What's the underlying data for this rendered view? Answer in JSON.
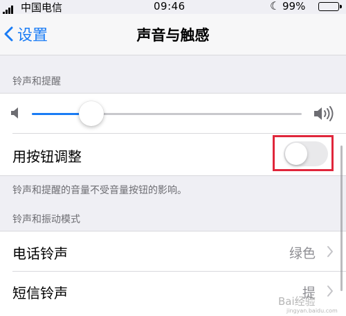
{
  "status_bar": {
    "carrier": "中国电信",
    "time": "09:46",
    "battery": "99%",
    "icons": [
      "signal-icon",
      "moon-icon",
      "battery-icon"
    ]
  },
  "nav": {
    "back_label": "设置",
    "title": "声音与触感"
  },
  "sections": {
    "ringer_header": "铃声和提醒",
    "ringer_footnote": "铃声和提醒的音量不受音量按钮的影响。",
    "patterns_header": "铃声和振动模式"
  },
  "volume": {
    "level": 0.22
  },
  "change_with_buttons": {
    "label": "用按钮调整",
    "enabled": false
  },
  "rows": [
    {
      "label": "电话铃声",
      "value": "绿色"
    },
    {
      "label": "短信铃声",
      "value": "提"
    }
  ],
  "watermark": {
    "brand": "Bai经验",
    "url": "jingyan.baidu.com"
  },
  "colors": {
    "accent": "#1a7cf5",
    "highlight": "#e0263b",
    "background": "#efeff4"
  }
}
